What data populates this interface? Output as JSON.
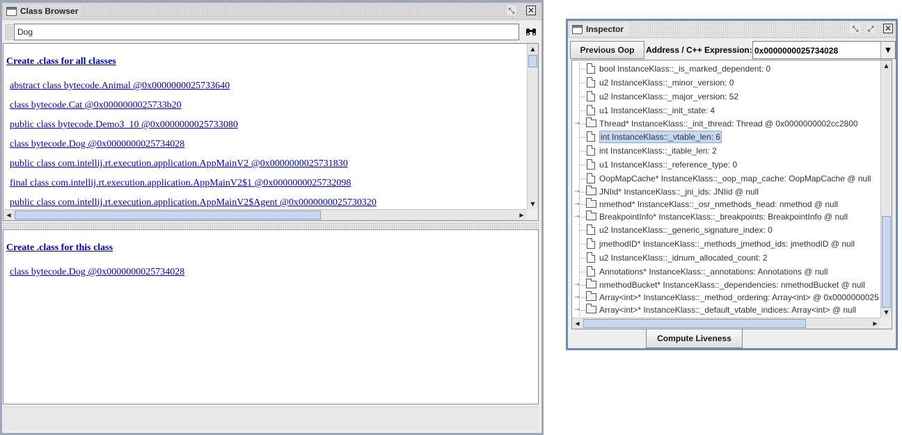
{
  "class_browser": {
    "title": "Class Browser",
    "search": {
      "value": "Dog"
    },
    "top_pane": {
      "heading": "Create .class for all classes",
      "classes": [
        "abstract class bytecode.Animal @0x0000000025733640",
        "class bytecode.Cat @0x0000000025733b20",
        "public class bytecode.Demo3_10 @0x0000000025733080",
        "class bytecode.Dog @0x0000000025734028",
        "public class com.intellij.rt.execution.application.AppMainV2 @0x0000000025731830",
        "final class com.intellij.rt.execution.application.AppMainV2$1 @0x0000000025732098",
        "public class com.intellij.rt.execution.application.AppMainV2$Agent @0x0000000025730320"
      ]
    },
    "bottom_pane": {
      "heading": "Create .class for this class",
      "classes": [
        "class bytecode.Dog @0x0000000025734028"
      ]
    }
  },
  "inspector": {
    "title": "Inspector",
    "previous_oop_label": "Previous Oop",
    "address_label": "Address / C++ Expression:",
    "address_value": "0x0000000025734028",
    "compute_label": "Compute Liveness",
    "nodes": [
      {
        "text": "bool InstanceKlass::_is_marked_dependent: 0",
        "expandable": false
      },
      {
        "text": "u2 InstanceKlass::_minor_version: 0",
        "expandable": false
      },
      {
        "text": "u2 InstanceKlass::_major_version: 52",
        "expandable": false
      },
      {
        "text": "u1 InstanceKlass::_init_state: 4",
        "expandable": false
      },
      {
        "text": "Thread* InstanceKlass::_init_thread: Thread @ 0x0000000002cc2800",
        "expandable": true
      },
      {
        "text": "int InstanceKlass::_vtable_len: 6",
        "expandable": false,
        "selected": true
      },
      {
        "text": "int InstanceKlass::_itable_len: 2",
        "expandable": false
      },
      {
        "text": "u1 InstanceKlass::_reference_type: 0",
        "expandable": false
      },
      {
        "text": "OopMapCache* InstanceKlass::_oop_map_cache: OopMapCache @ null",
        "expandable": false
      },
      {
        "text": "JNIid* InstanceKlass::_jni_ids: JNIid @ null",
        "expandable": true
      },
      {
        "text": "nmethod* InstanceKlass::_osr_nmethods_head: nmethod @ null",
        "expandable": true
      },
      {
        "text": "BreakpointInfo* InstanceKlass::_breakpoints: BreakpointInfo @ null",
        "expandable": true
      },
      {
        "text": "u2 InstanceKlass::_generic_signature_index: 0",
        "expandable": false
      },
      {
        "text": "jmethodID* InstanceKlass::_methods_jmethod_ids: jmethodID @ null",
        "expandable": false
      },
      {
        "text": "u2 InstanceKlass::_idnum_allocated_count: 2",
        "expandable": false
      },
      {
        "text": "Annotations* InstanceKlass::_annotations: Annotations @ null",
        "expandable": false
      },
      {
        "text": "nmethodBucket* InstanceKlass::_dependencies: nmethodBucket @ null",
        "expandable": true
      },
      {
        "text": "Array<int>* InstanceKlass::_method_ordering: Array<int> @ 0x0000000025",
        "expandable": true
      },
      {
        "text": "Array<int>* InstanceKlass::_default_vtable_indices: Array<int> @ null",
        "expandable": true
      }
    ]
  }
}
